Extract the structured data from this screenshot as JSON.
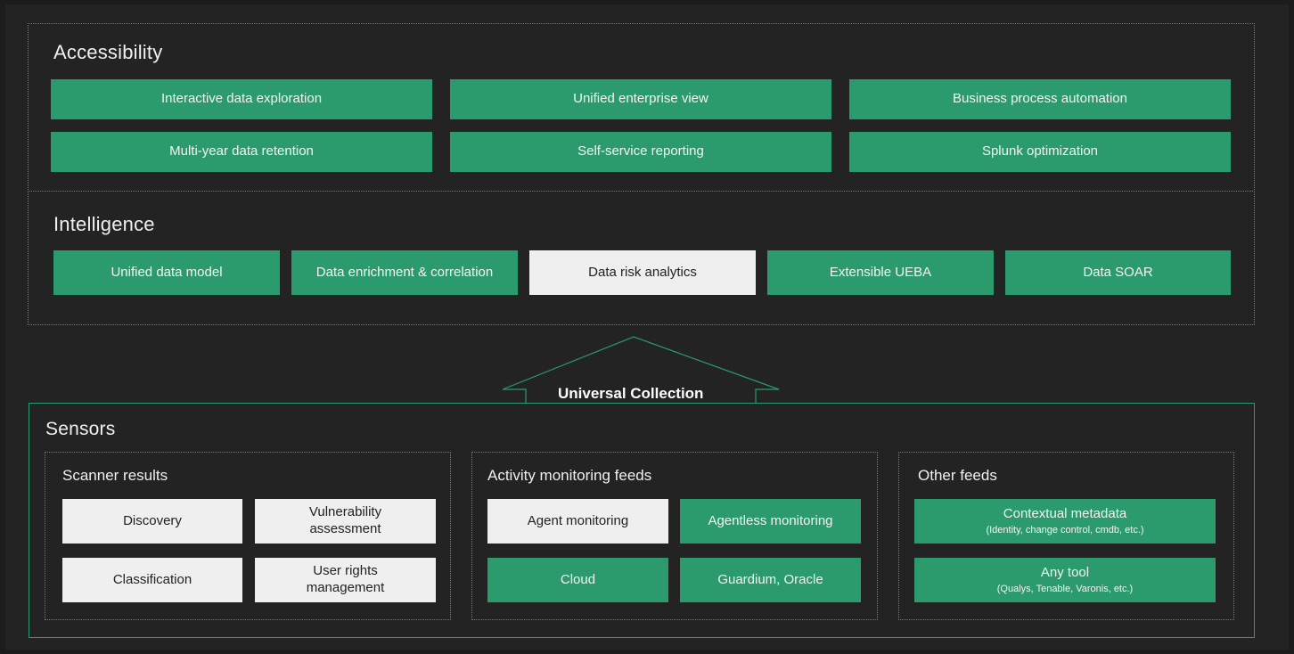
{
  "accessibility": {
    "title": "Accessibility",
    "items": [
      "Interactive data exploration",
      "Unified enterprise view",
      "Business process automation",
      "Multi-year data retention",
      "Self-service reporting",
      "Splunk optimization"
    ]
  },
  "intelligence": {
    "title": "Intelligence",
    "items": [
      "Unified data model",
      "Data enrichment & correlation",
      "Data risk analytics",
      "Extensible UEBA",
      "Data SOAR"
    ]
  },
  "collection": {
    "label": "Universal Collection"
  },
  "sensors": {
    "title": "Sensors",
    "scanner": {
      "title": "Scanner results",
      "items": [
        "Discovery",
        "Vulnerability assessment",
        "Classification",
        "User rights management"
      ]
    },
    "activity": {
      "title": "Activity monitoring feeds",
      "items": [
        "Agent monitoring",
        "Agentless monitoring",
        "Cloud",
        "Guardium, Oracle"
      ]
    },
    "other": {
      "title": "Other feeds",
      "items": [
        {
          "label": "Contextual metadata",
          "sub": "(Identity, change control, cmdb, etc.)"
        },
        {
          "label": "Any tool",
          "sub": "(Qualys, Tenable, Varonis, etc.)"
        }
      ]
    }
  },
  "colors": {
    "green": "#2b9a6c",
    "light": "#efefef",
    "background": "#232323"
  }
}
